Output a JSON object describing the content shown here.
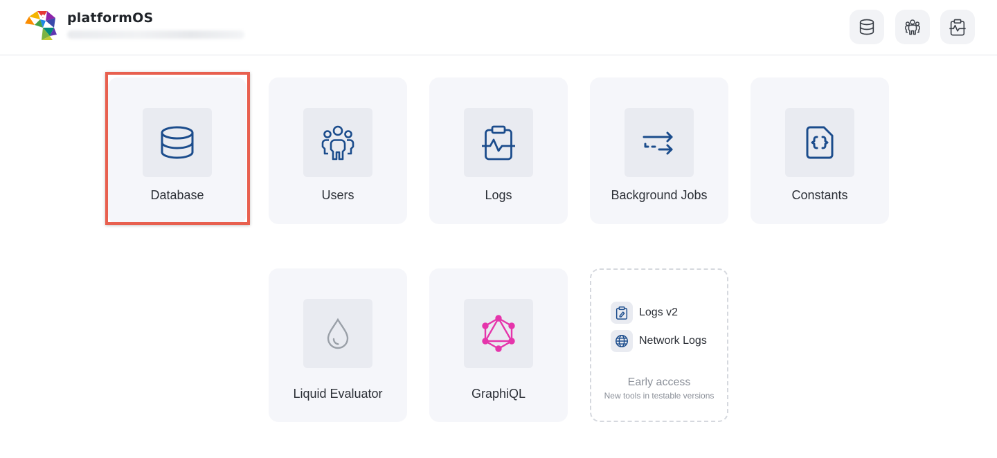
{
  "header": {
    "brand": "platformOS",
    "buttons": [
      {
        "name": "database-shortcut",
        "icon": "database-icon"
      },
      {
        "name": "users-shortcut",
        "icon": "users-icon"
      },
      {
        "name": "logs-shortcut",
        "icon": "logs-icon"
      }
    ]
  },
  "tiles": [
    {
      "label": "Database",
      "icon": "database-icon"
    },
    {
      "label": "Users",
      "icon": "users-icon"
    },
    {
      "label": "Logs",
      "icon": "logs-icon"
    },
    {
      "label": "Background Jobs",
      "icon": "background-jobs-icon"
    },
    {
      "label": "Constants",
      "icon": "constants-icon"
    },
    {
      "label": "Liquid Evaluator",
      "icon": "liquid-drop-icon"
    },
    {
      "label": "GraphiQL",
      "icon": "graphql-icon"
    }
  ],
  "early_access": {
    "items": [
      {
        "label": "Logs v2",
        "icon": "logs-v2-icon"
      },
      {
        "label": "Network Logs",
        "icon": "globe-icon"
      }
    ],
    "title": "Early access",
    "subtitle": "New tools in testable versions"
  },
  "colors": {
    "icon_blue": "#1b4c8c",
    "graphql_pink": "#e535ab",
    "highlight_red": "#e8604f",
    "tile_bg": "#f5f6fa",
    "icon_box_bg": "#e9ebf1"
  }
}
